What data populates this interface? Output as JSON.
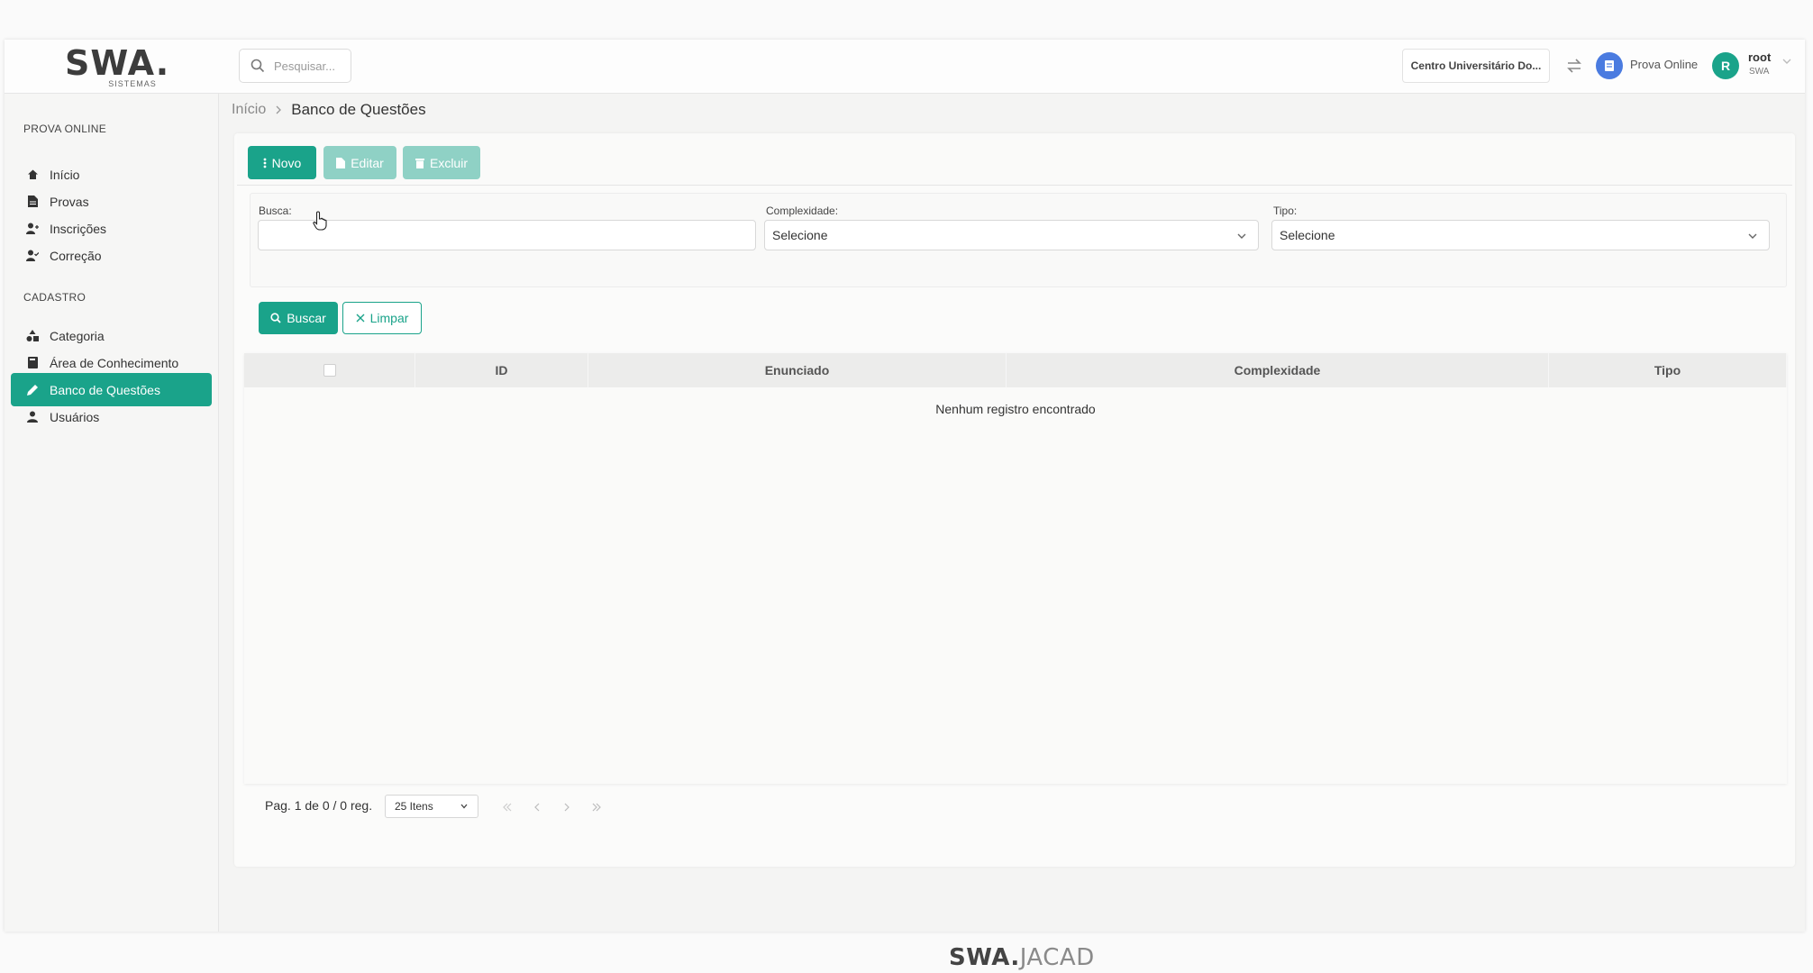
{
  "header": {
    "logo_text": "SWA.",
    "logo_sub": "SISTEMAS",
    "search_placeholder": "Pesquisar...",
    "institution": "Centro Universitário Do...",
    "module_label": "Prova Online",
    "avatar_initial": "R",
    "user_name": "root",
    "user_org": "SWA"
  },
  "sidebar": {
    "section_prova": "PROVA ONLINE",
    "section_cadastro": "CADASTRO",
    "items": [
      {
        "label": "Início",
        "icon": "home-icon"
      },
      {
        "label": "Provas",
        "icon": "document-icon"
      },
      {
        "label": "Inscrições",
        "icon": "user-add-icon"
      },
      {
        "label": "Correção",
        "icon": "user-check-icon"
      },
      {
        "label": "Categoria",
        "icon": "shapes-icon"
      },
      {
        "label": "Área de Conhecimento",
        "icon": "book-icon"
      },
      {
        "label": "Banco de Questões",
        "icon": "pencil-icon",
        "active": true
      },
      {
        "label": "Usuários",
        "icon": "user-icon"
      }
    ]
  },
  "breadcrumb": {
    "home": "Início",
    "current": "Banco de Questões"
  },
  "toolbar": {
    "novo": "Novo",
    "editar": "Editar",
    "excluir": "Excluir"
  },
  "filters": {
    "busca_label": "Busca:",
    "busca_value": "",
    "complexidade_label": "Complexidade:",
    "complexidade_value": "Selecione",
    "tipo_label": "Tipo:",
    "tipo_value": "Selecione",
    "buscar": "Buscar",
    "limpar": "Limpar"
  },
  "table": {
    "columns": [
      "ID",
      "Enunciado",
      "Complexidade",
      "Tipo"
    ],
    "empty_message": "Nenhum registro encontrado"
  },
  "pagination": {
    "summary": "Pag. 1 de 0 / 0 reg.",
    "per_page": "25 Itens"
  },
  "footer": {
    "brand_bold": "SWA.",
    "brand_light": "JACAD"
  },
  "colors": {
    "accent": "#1aa38a",
    "accent_disabled": "#8fd1c5"
  }
}
